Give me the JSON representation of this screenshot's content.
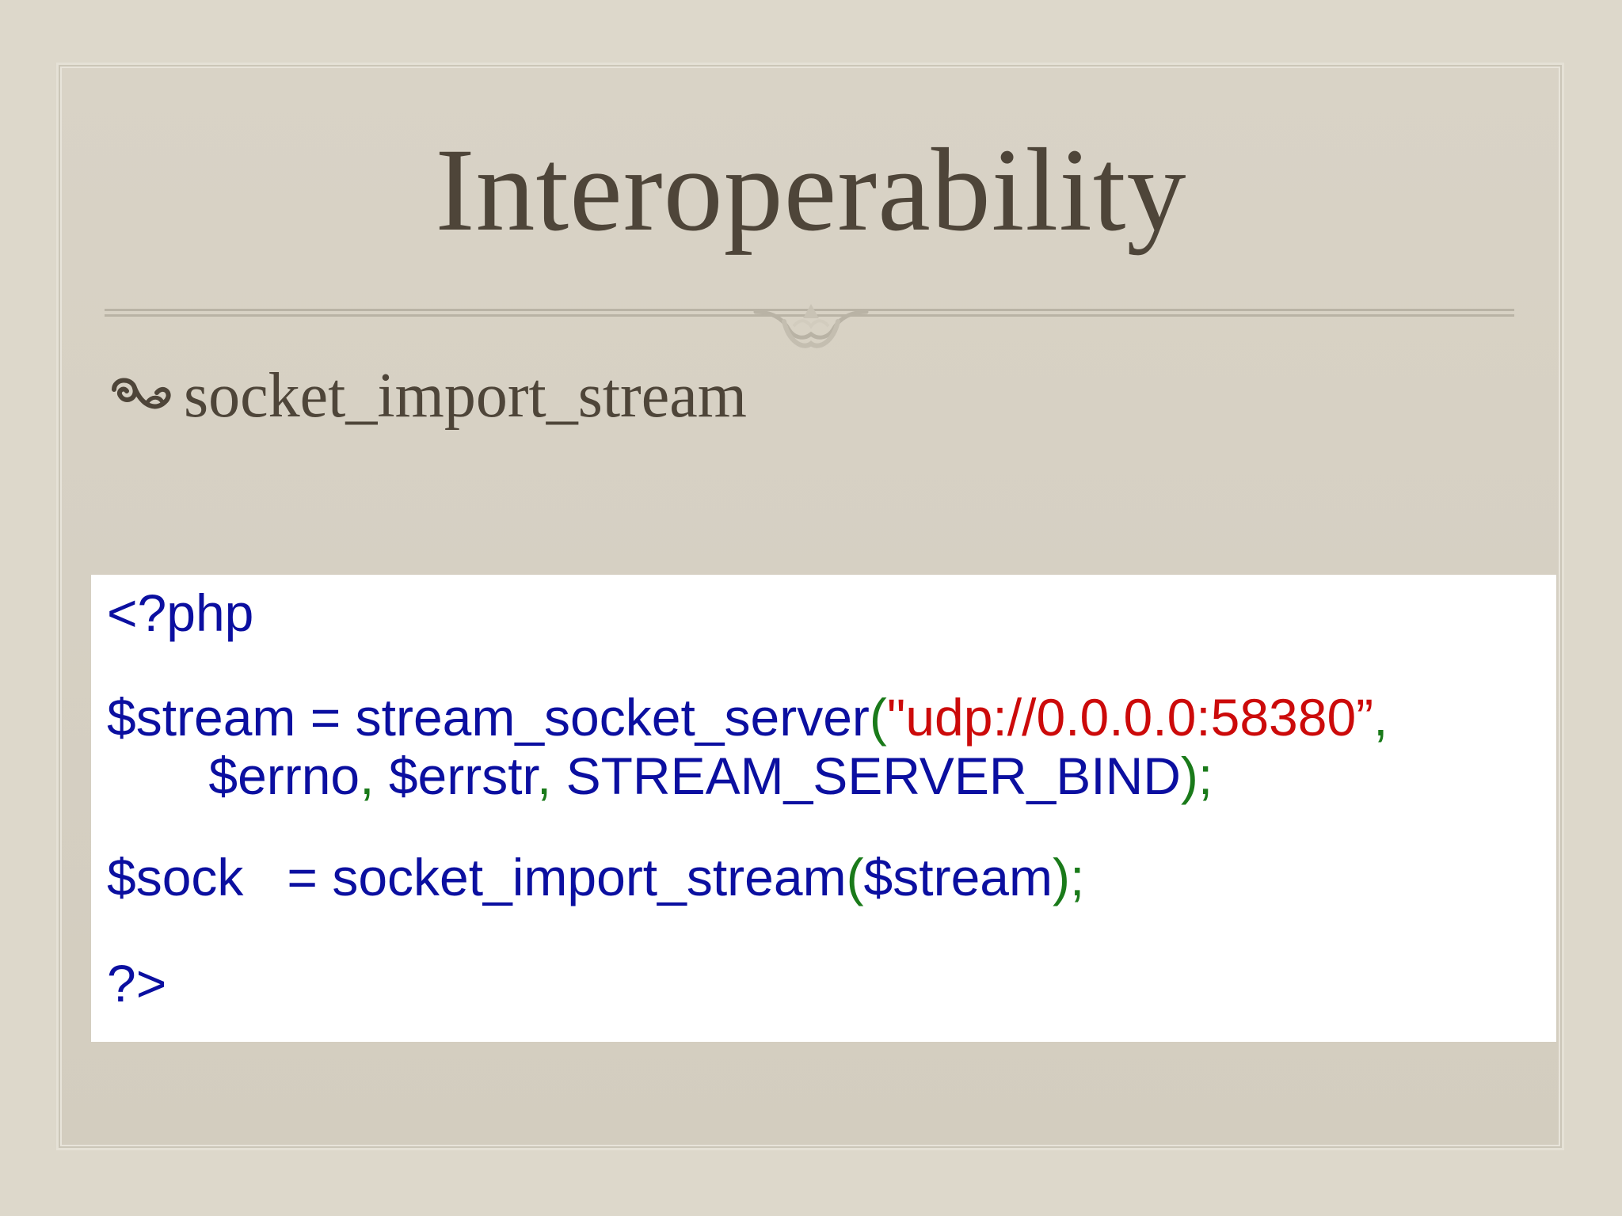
{
  "slide": {
    "title": "Interoperability",
    "bullet": "socket_import_stream",
    "icons": {
      "divider_ornament": "scroll-ornament-icon",
      "bullet": "fleuron-bullet-icon"
    }
  },
  "code": {
    "line1": {
      "open_tag": "<?php"
    },
    "line2": {
      "var": "$stream",
      "assign": " = ",
      "func": "stream_socket_server",
      "paren_open": "(",
      "quote_open": "\"",
      "string": "udp://0.0.0.0:58380",
      "quote_close": "”",
      "comma": ","
    },
    "line3": {
      "indent": "       ",
      "arg1": "$errno",
      "comma1": ", ",
      "arg2": "$errstr",
      "comma2": ", ",
      "arg3": "STREAM_SERVER_BIND",
      "close": ");"
    },
    "line4": {
      "var": "$sock",
      "assign": "   = ",
      "func": "socket_import_stream",
      "paren_open": "(",
      "arg": "$stream",
      "close": ");"
    },
    "line5": {
      "close_tag": "?>"
    }
  },
  "colors": {
    "background": "#ddd8cb",
    "title_text": "#4e4539",
    "code_identifier": "#0b0fa0",
    "code_punctuation": "#1a7a1a",
    "code_string": "#cc0a0a",
    "code_background": "#ffffff"
  }
}
